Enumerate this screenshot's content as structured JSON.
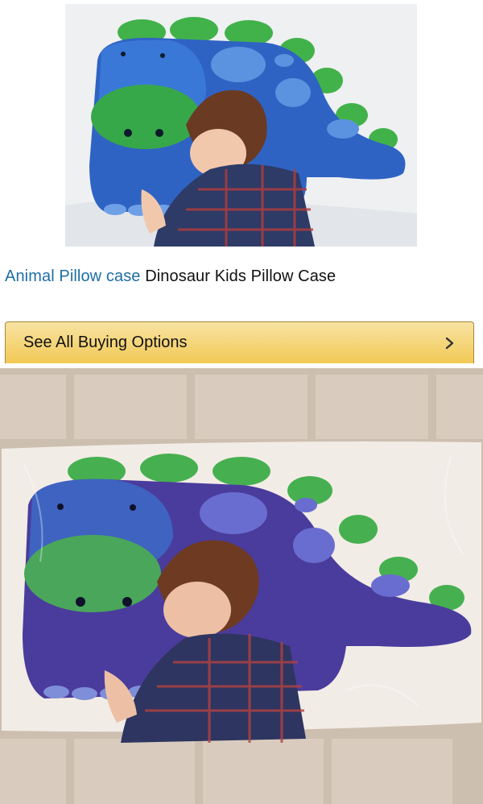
{
  "listing": {
    "title_link": "Animal Pillow case",
    "title_rest": "Dinosaur Kids Pillow Case"
  },
  "buy_button": {
    "label": "See All Buying Options",
    "icon": "chevron-right-icon"
  },
  "colors": {
    "link": "#1d6fa5",
    "button_top": "#f8e3a3",
    "button_bottom": "#f2c955",
    "button_border": "#a88734",
    "dino_blue": "#2f63c3",
    "dino_purple": "#4b3a9a",
    "spike_green": "#3fae45"
  }
}
